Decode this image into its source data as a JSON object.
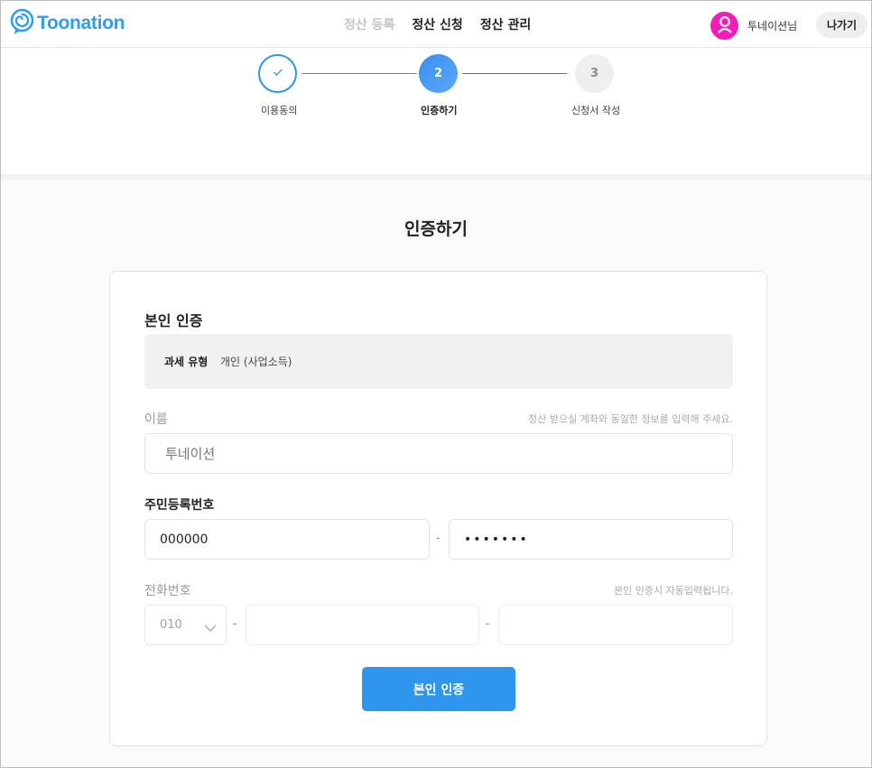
{
  "header": {
    "logo_text": "Toonation",
    "nav": [
      {
        "label": "정산 등록"
      },
      {
        "label": "정산 신청"
      },
      {
        "label": "정산 관리"
      }
    ],
    "username": "투네이션님",
    "exit_label": "나가기"
  },
  "stepper": {
    "steps": [
      {
        "number": "✓",
        "label": "이용동의",
        "state": "done"
      },
      {
        "number": "2",
        "label": "인증하기",
        "state": "active"
      },
      {
        "number": "3",
        "label": "신청서 작성",
        "state": "pending"
      }
    ]
  },
  "page": {
    "title": "인증하기"
  },
  "form": {
    "section_title": "본인 인증",
    "tax_type_label": "과세 유형",
    "tax_type_value": "개인 (사업소득)",
    "name_label": "이름",
    "name_hint": "정산 받으실 계좌와 동일한 정보를 입력해 주세요.",
    "name_value": "투네이션",
    "rrn_label": "주민등록번호",
    "rrn_front": "000000",
    "rrn_back": "•••••••",
    "rrn_dash": "-",
    "phone_label": "전화번호",
    "phone_hint": "본인 인증시 자동입력됩니다.",
    "phone_prefix": "010",
    "phone_dash": "-",
    "submit_label": "본인 인증"
  },
  "colors": {
    "accent": "#2f96ee",
    "avatar": "#f31cb9"
  },
  "icons": {
    "logo": "toonation-logo-icon",
    "avatar": "user-icon",
    "step_done": "check-icon",
    "select": "chevron-down-icon"
  }
}
